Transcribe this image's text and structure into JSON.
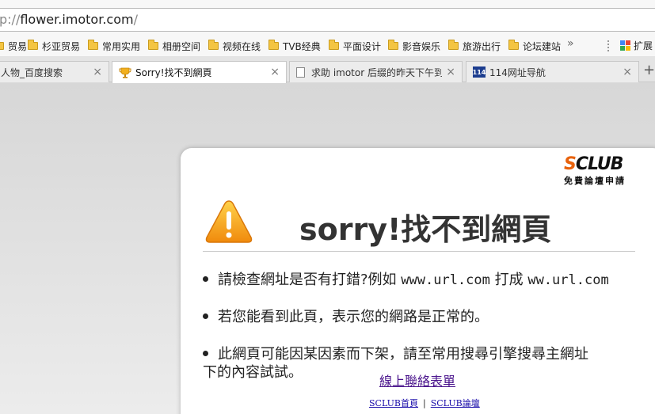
{
  "address_bar": {
    "prefix": "p://",
    "host": "flower.imotor.com",
    "suffix": "/"
  },
  "bookmarks": [
    {
      "label": "贸易"
    },
    {
      "label": "杉亚贸易"
    },
    {
      "label": "常用实用"
    },
    {
      "label": "相册空间"
    },
    {
      "label": "视频在线"
    },
    {
      "label": "TVB经典"
    },
    {
      "label": "平面设计"
    },
    {
      "label": "影音娱乐"
    },
    {
      "label": "旅游出行"
    },
    {
      "label": "论坛建站"
    }
  ],
  "bookmarks_more": "»",
  "extensions_label": "扩展",
  "tabs": [
    {
      "label": "人物_百度搜索",
      "close": "×"
    },
    {
      "label": "Sorry!找不到網頁",
      "close": "×",
      "active": true
    },
    {
      "label": "求助 imotor 后缀的昨天下午到",
      "close": "×"
    },
    {
      "label": "114网址导航",
      "close": "×",
      "icon_text": "114"
    }
  ],
  "new_tab": "+",
  "page": {
    "logo_prefix": "S",
    "logo_rest": "CLUB",
    "logo_sub": "免費論壇申請",
    "title": "sorry!找不到網頁",
    "item1_text": "請檢查網址是否有打錯?例如 ",
    "item1_url1": "www.url.com",
    "item1_mid": " 打成 ",
    "item1_url2": "ww.url.com",
    "item2_text": "若您能看到此頁，表示您的網路是正常的。",
    "item3_line1": "此網頁可能因某因素而下架，請至常用搜尋引擎搜尋主網址",
    "item3_line2": "下的內容試試。",
    "contact_link": "線上聯絡表單",
    "footer_link1": "SCLUB首頁",
    "footer_sep": "|",
    "footer_link2": "SCLUB論壇"
  },
  "colors": {
    "accent_orange": "#e8620c",
    "link_purple": "#4a148c",
    "warning_yellow": "#f5a623"
  }
}
